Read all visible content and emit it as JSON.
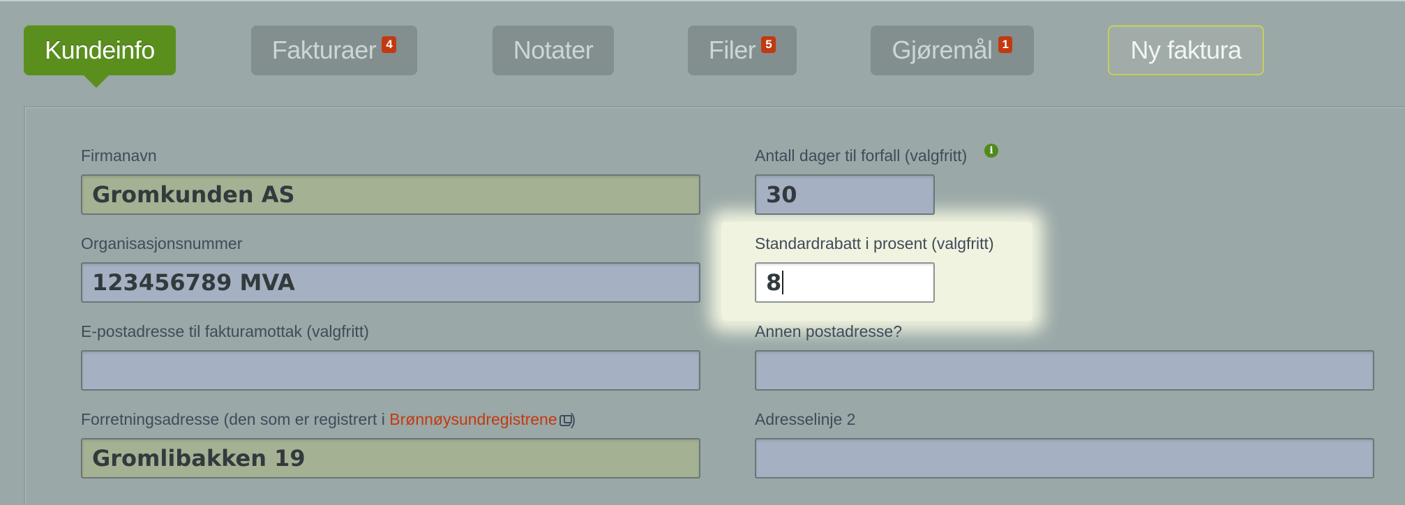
{
  "tabs": [
    {
      "label": "Kundeinfo",
      "badge": null,
      "active": true
    },
    {
      "label": "Fakturaer",
      "badge": "4"
    },
    {
      "label": "Notater",
      "badge": null
    },
    {
      "label": "Filer",
      "badge": "5"
    },
    {
      "label": "Gjøremål",
      "badge": "1"
    },
    {
      "label": "Ny faktura",
      "badge": null
    }
  ],
  "form": {
    "firmanavn": {
      "label": "Firmanavn",
      "value": "Gromkunden AS"
    },
    "orgnr": {
      "label": "Organisasjonsnummer",
      "value": "123456789 MVA"
    },
    "epost": {
      "label": "E-postadresse til fakturamottak (valgfritt)",
      "value": ""
    },
    "forretningsadresse": {
      "label_prefix": "Forretningsadresse (den som er registrert i ",
      "link": "Brønnøysundregistrene",
      "label_suffix": ")",
      "value": "Gromlibakken 19"
    },
    "forfall": {
      "label": "Antall dager til forfall (valgfritt)",
      "value": "30"
    },
    "rabatt": {
      "label": "Standardrabatt i prosent (valgfritt)",
      "value": "8"
    },
    "postadresse": {
      "label": "Annen postadresse?",
      "value": ""
    },
    "adresselinje2": {
      "label": "Adresselinje 2",
      "value": ""
    }
  },
  "icons": {
    "info": "info-icon",
    "external": "external-link-icon"
  },
  "colors": {
    "active_tab": "#5a8f1d",
    "badge": "#c23a10",
    "link": "#c23a10"
  }
}
